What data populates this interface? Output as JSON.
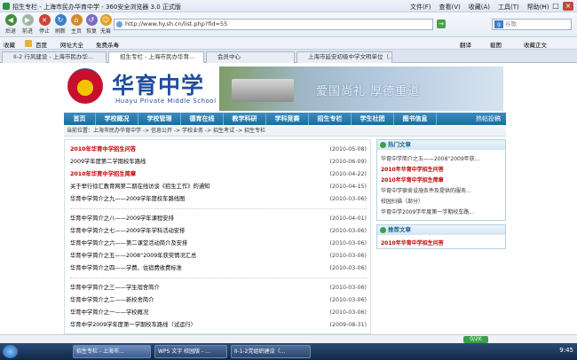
{
  "window": {
    "title": "招生专栏 - 上海市民办华育中学 - 360安全浏览器 3.0 正式版",
    "menu": [
      "文件(F)",
      "查看(V)",
      "收藏(A)",
      "工具(T)",
      "帮助(H)"
    ]
  },
  "toolbar": {
    "buttons": [
      "后退",
      "前进",
      "停止",
      "刷新",
      "主页",
      "恢复",
      "无痕"
    ],
    "address": "http://www.hy.sh.cn/list.php?fid=55",
    "search_placeholder": "谷歌"
  },
  "favbar": {
    "items": [
      "收藏",
      "百度",
      "网址大全",
      "免费杀毒"
    ],
    "right_items": [
      "翻译",
      "截图",
      "收藏正文"
    ]
  },
  "tabs": [
    {
      "label": "II-2 行风建设 - 上海市民办华..."
    },
    {
      "label": "招生专栏 - 上海市民办华育..."
    },
    {
      "label": "会员中心"
    },
    {
      "label": "上海市延安初级中学文明单位（..."
    }
  ],
  "banner": {
    "school_cn": "华育中学",
    "school_en": "Huayu Private Middle School",
    "motto": "爱国尚礼  厚德重道"
  },
  "nav": {
    "items": [
      "首页",
      "学校概况",
      "学校管理",
      "德育在线",
      "教学科研",
      "学科竞赛",
      "招生专栏",
      "学生社团",
      "图书信息"
    ],
    "rss": "热帖投稿"
  },
  "breadcrumb": "当前位置：上海市民办华育中学 -> 信息公开 -> 学校业务 -> 招生考试 -> 招生专栏",
  "news_groups": [
    [
      {
        "text": "2010年华育中学招生问答",
        "date": "(2010-05-08)",
        "red": true
      },
      {
        "text": "2009学年度第二学期校车路线",
        "date": "(2010-06-09)",
        "red": false
      },
      {
        "text": "2010年华育中学招生简章",
        "date": "(2010-04-22)",
        "red": true
      },
      {
        "text": "关于举行徐汇教育网第二期在线访谈《招生工作》的通知",
        "date": "(2010-04-15)",
        "red": false
      },
      {
        "text": "华育中学简介之九——2009学年度校车路线图",
        "date": "(2010-03-06)",
        "red": false
      }
    ],
    [
      {
        "text": "华育中学简介之八——2009学年课程安排",
        "date": "(2010-04-01)",
        "red": false
      },
      {
        "text": "华育中学简介之七——2009学年学科活动安排",
        "date": "(2010-03-06)",
        "red": false
      },
      {
        "text": "华育中学简介之六——第二课堂活动简介及安排",
        "date": "(2010-03-06)",
        "red": false
      },
      {
        "text": "华育中学简介之五——2008“2009年获奖情况汇总",
        "date": "(2010-03-06)",
        "red": false
      },
      {
        "text": "华育中学简介之四——学费、住宿费收费标准",
        "date": "(2010-03-06)",
        "red": false
      }
    ],
    [
      {
        "text": "华育中学简介之三——学生宿舍简介",
        "date": "(2010-03-06)",
        "red": false
      },
      {
        "text": "华育中学简介之二——新校舍简介",
        "date": "(2010-03-06)",
        "red": false
      },
      {
        "text": "华育中学简介之一——学校概况",
        "date": "(2010-03-06)",
        "red": false
      },
      {
        "text": "华育中学2009学年度第一学期校车路线（试运行）",
        "date": "(2009-08-31)",
        "red": false
      }
    ]
  ],
  "hot": {
    "title": "热门文章",
    "items": [
      {
        "text": "华育中学简介之五——2008“2009年获...",
        "red": false
      },
      {
        "text": "2010年华育中学招生问答",
        "red": true
      },
      {
        "text": "2010年华育中学招生简章",
        "red": true
      },
      {
        "text": "华育中学宿舍设施条件及提供的服务...",
        "red": false
      },
      {
        "text": "校园扫描（部分）",
        "red": false
      },
      {
        "text": "华育中学2009学年度第一学期校车路...",
        "red": false
      }
    ]
  },
  "recommended": {
    "title": "推荐文章",
    "items": [
      {
        "text": "2010年华育中学招生问答",
        "red": true
      }
    ]
  },
  "statusbar": {
    "zoom": "0/2K"
  },
  "taskbar": {
    "tasks": [
      "招生专栏 - 上海市...",
      "WPS 文字 校园版 - ...",
      "II-1-2党组织建设（..."
    ],
    "time": "9:45"
  },
  "colors": {
    "accent": "#1f6a98",
    "title": "#1f4e9b",
    "highlight": "#c00000"
  }
}
